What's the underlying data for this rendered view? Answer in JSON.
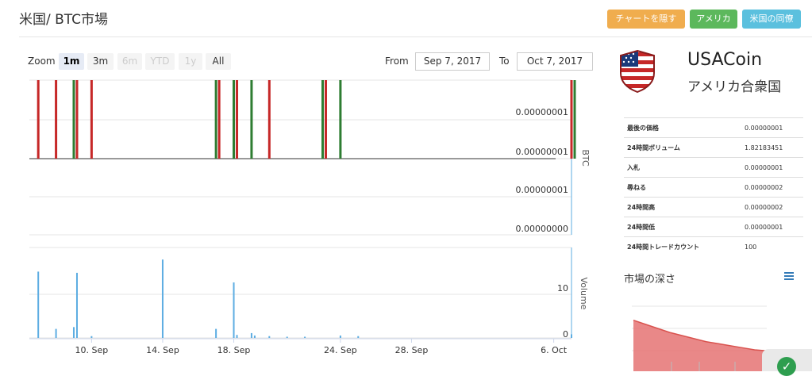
{
  "header": {
    "title": "米国/ BTC市場",
    "buttons": {
      "hide_chart": "チャートを隠す",
      "usa": "アメリカ",
      "peers": "米国の同僚"
    }
  },
  "range_selector": {
    "zoom_label": "Zoom",
    "buttons": [
      {
        "label": "1m",
        "state": "active"
      },
      {
        "label": "3m",
        "state": "normal"
      },
      {
        "label": "6m",
        "state": "disabled"
      },
      {
        "label": "YTD",
        "state": "disabled"
      },
      {
        "label": "1y",
        "state": "disabled"
      },
      {
        "label": "All",
        "state": "normal"
      }
    ],
    "from_label": "From",
    "from_value": "Sep 7, 2017",
    "to_label": "To",
    "to_value": "Oct 7, 2017"
  },
  "coin": {
    "name": "USACoin",
    "subtitle": "アメリカ合衆国"
  },
  "stats": [
    {
      "label": "最後の価格",
      "value": "0.00000001"
    },
    {
      "label": "24時間ボリューム",
      "value": "1.82183451"
    },
    {
      "label": "入札",
      "value": "0.00000001"
    },
    {
      "label": "尋ねる",
      "value": "0.00000002"
    },
    {
      "label": "24時間高",
      "value": "0.00000002"
    },
    {
      "label": "24時間低",
      "value": "0.00000001"
    },
    {
      "label": "24時間トレードカウント",
      "value": "100"
    }
  ],
  "depth": {
    "title": "市場の深さ"
  },
  "colors": {
    "up": "#2e7d32",
    "down": "#c62828",
    "volume": "#5dade2",
    "depth_fill": "#e57373",
    "depth_line": "#d9534f"
  },
  "chart_data": {
    "type": "candlestick",
    "x_tick_labels": [
      "10. Sep",
      "14. Sep",
      "18. Sep",
      "24. Sep",
      "28. Sep",
      "6. Oct"
    ],
    "price_axis": {
      "label": "BTC",
      "tick_labels": [
        "0.00000001",
        "0.00000001",
        "0.00000001",
        "0.00000000"
      ]
    },
    "volume_axis": {
      "label": "Volume",
      "tick_labels": [
        "10",
        "0"
      ],
      "ylim": [
        0,
        15
      ]
    },
    "candles_high_low": [
      {
        "date": "2017-09-07",
        "dir": "down"
      },
      {
        "date": "2017-09-08",
        "dir": "down"
      },
      {
        "date": "2017-09-09",
        "dir": "up"
      },
      {
        "date": "2017-09-09",
        "dir": "down"
      },
      {
        "date": "2017-09-10",
        "dir": "down"
      },
      {
        "date": "2017-09-17",
        "dir": "up"
      },
      {
        "date": "2017-09-17",
        "dir": "down"
      },
      {
        "date": "2017-09-18",
        "dir": "up"
      },
      {
        "date": "2017-09-18",
        "dir": "down"
      },
      {
        "date": "2017-09-19",
        "dir": "up"
      },
      {
        "date": "2017-09-20",
        "dir": "down"
      },
      {
        "date": "2017-09-23",
        "dir": "up"
      },
      {
        "date": "2017-09-23",
        "dir": "down"
      },
      {
        "date": "2017-09-24",
        "dir": "up"
      },
      {
        "date": "2017-10-07",
        "dir": "down"
      },
      {
        "date": "2017-10-07",
        "dir": "up"
      }
    ],
    "volume": [
      {
        "date": "2017-09-07",
        "value": 11
      },
      {
        "date": "2017-09-08",
        "value": 1.5
      },
      {
        "date": "2017-09-09",
        "value": 1.8
      },
      {
        "date": "2017-09-09",
        "value": 10.8
      },
      {
        "date": "2017-09-10",
        "value": 0.3
      },
      {
        "date": "2017-09-14",
        "value": 13
      },
      {
        "date": "2017-09-17",
        "value": 1.5
      },
      {
        "date": "2017-09-18",
        "value": 9.2
      },
      {
        "date": "2017-09-18",
        "value": 0.5
      },
      {
        "date": "2017-09-19",
        "value": 0.8
      },
      {
        "date": "2017-09-19",
        "value": 0.4
      },
      {
        "date": "2017-09-20",
        "value": 0.3
      },
      {
        "date": "2017-09-21",
        "value": 0.2
      },
      {
        "date": "2017-09-22",
        "value": 0.2
      },
      {
        "date": "2017-09-24",
        "value": 0.4
      },
      {
        "date": "2017-09-25",
        "value": 0.3
      },
      {
        "date": "2017-10-07",
        "value": 0.6
      }
    ],
    "depth_curve": [
      5.0,
      4.6,
      4.2,
      3.8,
      3.5,
      3.2,
      2.9,
      2.7,
      2.5,
      2.3,
      2.1,
      2.0
    ]
  }
}
